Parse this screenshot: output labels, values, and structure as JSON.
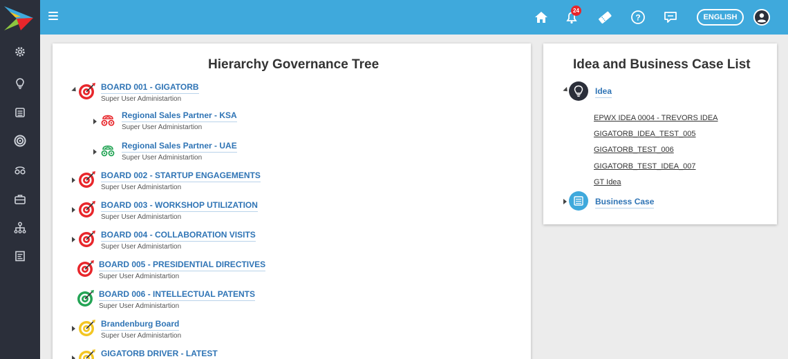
{
  "header": {
    "notification_count": "24",
    "language_label": "ENGLISH"
  },
  "colors": {
    "header_bg": "#3fa9dc",
    "sidebar_bg": "#2b2f3a",
    "link_blue": "#2f74b5",
    "red": "#e8262b",
    "green": "#23a455",
    "yellow": "#f3c623"
  },
  "tree": {
    "title": "Hierarchy Governance Tree",
    "nodes": [
      {
        "title": "BOARD 001 - GIGATORB",
        "subtitle": "Super User Administartion"
      },
      {
        "title": "Regional Sales Partner - KSA",
        "subtitle": "Super User Administartion"
      },
      {
        "title": "Regional Sales Partner - UAE",
        "subtitle": "Super User Administartion"
      },
      {
        "title": "BOARD 002 - STARTUP ENGAGEMENTS",
        "subtitle": "Super User Administartion"
      },
      {
        "title": "BOARD 003 - WORKSHOP UTILIZATION",
        "subtitle": "Super User Administartion"
      },
      {
        "title": "BOARD 004 - COLLABORATION VISITS",
        "subtitle": "Super User Administartion"
      },
      {
        "title": "BOARD 005 - PRESIDENTIAL DIRECTIVES",
        "subtitle": "Super User Administartion"
      },
      {
        "title": "BOARD 006 - INTELLECTUAL PATENTS",
        "subtitle": "Super User Administartion"
      },
      {
        "title": "Brandenburg Board",
        "subtitle": "Super User Administartion"
      },
      {
        "title": "GIGATORB DRIVER - LATEST",
        "subtitle": ""
      }
    ]
  },
  "ideas": {
    "title": "Idea and Business Case List",
    "idea_group": "Idea",
    "items": [
      "EPWX IDEA 0004 - TREVORS IDEA",
      "GIGATORB_IDEA_TEST_005",
      "GIGATORB_TEST_006",
      "GIGATORB_TEST_IDEA_007",
      "GT Idea"
    ],
    "business_group": "Business Case"
  }
}
